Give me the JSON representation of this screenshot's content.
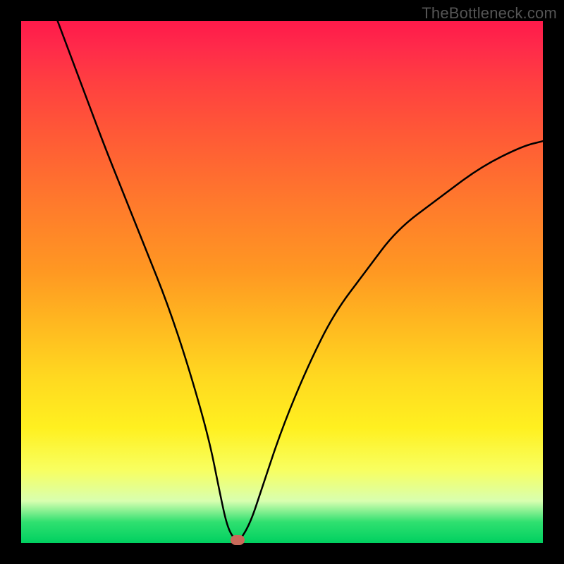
{
  "watermark": "TheBottleneck.com",
  "chart_data": {
    "type": "line",
    "title": "",
    "xlabel": "",
    "ylabel": "",
    "xlim": [
      0,
      100
    ],
    "ylim": [
      0,
      100
    ],
    "series": [
      {
        "name": "curve",
        "x": [
          7,
          10,
          13,
          16,
          20,
          24,
          28,
          32,
          36,
          38,
          39.5,
          41,
          42,
          44,
          46,
          50,
          55,
          60,
          66,
          72,
          80,
          88,
          96,
          100
        ],
        "y": [
          100,
          92,
          84,
          76,
          66,
          56,
          46,
          34,
          20,
          10,
          3,
          0.5,
          0.5,
          4,
          10,
          22,
          34,
          44,
          52,
          60,
          66,
          72,
          76,
          77
        ]
      }
    ],
    "marker": {
      "x": 41.5,
      "y": 0.5,
      "color": "#c96a5a"
    },
    "background_gradient": {
      "direction": "vertical",
      "stops": [
        {
          "pos": 0,
          "color": "#ff1a4a"
        },
        {
          "pos": 35,
          "color": "#ff7a2c"
        },
        {
          "pos": 68,
          "color": "#ffd820"
        },
        {
          "pos": 92,
          "color": "#d8ffb0"
        },
        {
          "pos": 100,
          "color": "#00d060"
        }
      ]
    }
  }
}
